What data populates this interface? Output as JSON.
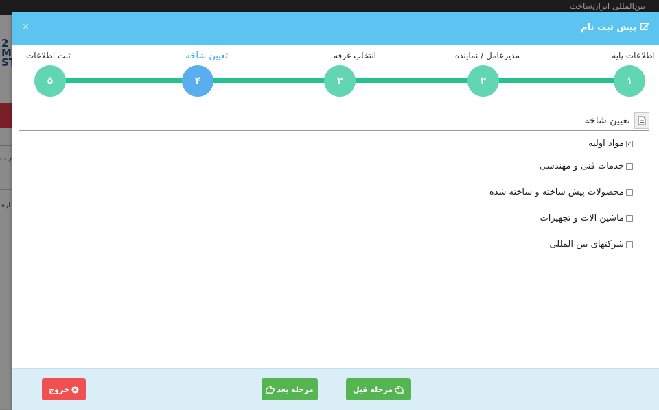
{
  "background": {
    "header_text": "بین‌المللی ایران‌ساخت",
    "logo_letters": "2\nM\nST",
    "frag1": "م ت",
    "frag2": "ازه"
  },
  "modal": {
    "title": "پیش ثبت نام",
    "close_label": "×"
  },
  "steps": [
    {
      "label": "اطلاعات پایه",
      "number": "۱",
      "active": false
    },
    {
      "label": "مدیرعامل / نماینده",
      "number": "۲",
      "active": false
    },
    {
      "label": "انتخاب غرفه",
      "number": "۳",
      "active": false
    },
    {
      "label": "تعیین شاخه",
      "number": "۴",
      "active": true
    },
    {
      "label": "ثبت اطلاعات",
      "number": "۵",
      "active": false
    }
  ],
  "section": {
    "title": "تعیین شاخه",
    "items": [
      {
        "label": "مواد اولیه",
        "checked": true
      },
      {
        "label": "خدمات فنی و مهندسی",
        "checked": false
      },
      {
        "label": "محصولات پیش ساخته و ساخته شده",
        "checked": false
      },
      {
        "label": "ماشین آلات و تجهیزات",
        "checked": false
      },
      {
        "label": "شرکتهای بین المللی",
        "checked": false
      }
    ]
  },
  "footer": {
    "prev_label": "مرحله قبل",
    "next_label": "مرحله بعد",
    "exit_label": "خروج"
  },
  "colors": {
    "header": "#5bc4f0",
    "step_done": "#62d6b0",
    "step_active": "#5aaef0",
    "progress_line": "#25c18e",
    "button_green": "#55b651",
    "button_red": "#f15050"
  }
}
